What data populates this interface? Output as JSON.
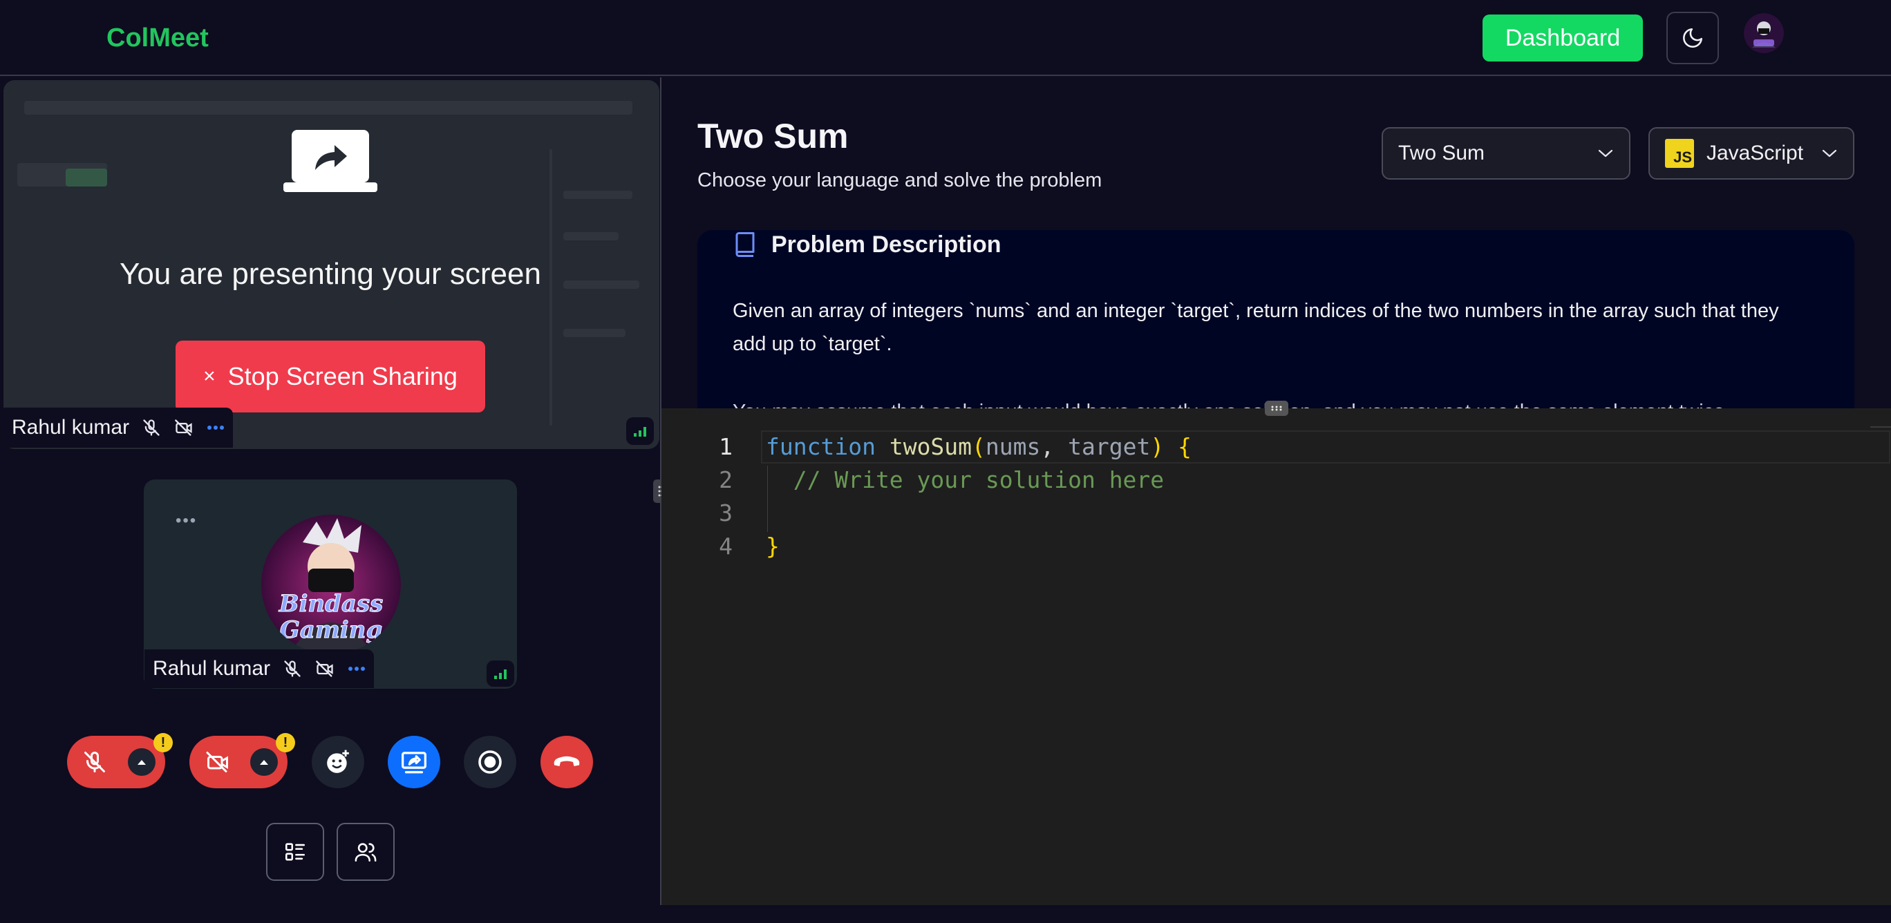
{
  "header": {
    "brand": "ColMeet",
    "dashboard_label": "Dashboard",
    "theme_icon": "moon-icon",
    "avatar_label": "Bindass Gaming"
  },
  "screen_share": {
    "message": "You are presenting your screen",
    "stop_label": "Stop Screen Sharing",
    "stop_icon": "×",
    "participant": "Rahul kumar"
  },
  "camera_tile": {
    "participant": "Rahul kumar",
    "avatar_text_1": "Bindass",
    "avatar_text_2": "Gaming"
  },
  "controls": {
    "warn_glyph": "!",
    "mic": "mic-off-icon",
    "camera": "camera-off-icon",
    "reactions": "emoji-icon",
    "share": "screen-share-icon",
    "record": "record-icon",
    "leave": "phone-hangup-icon",
    "layout": "layout-list-icon",
    "participants": "users-icon"
  },
  "problem": {
    "title": "Two Sum",
    "subtitle": "Choose your language and solve the problem",
    "selected_problem": "Two Sum",
    "selected_language": "JavaScript",
    "language_badge": "JS",
    "description_heading": "Problem Description",
    "description": "Given an array of integers `nums` and an integer `target`, return indices of the two numbers in the array such that they add up to `target`.",
    "description_next": "You may assume that each input would have exactly one solution, and you may not use the same element twice."
  },
  "editor": {
    "line_numbers": [
      "1",
      "2",
      "3",
      "4"
    ],
    "tokens": {
      "kw_function": "function",
      "fn_name": "twoSum",
      "paren_open": "(",
      "param_1": "nums",
      "comma": ", ",
      "param_2": "target",
      "paren_close": ")",
      "brace_open": " {",
      "comment": "  // Write your solution here",
      "brace_close": "}"
    }
  },
  "colors": {
    "brand": "#22c55e",
    "dashboard": "#13d962",
    "stop": "#f03b4c",
    "share_active": "#0d6efd",
    "leave": "#e03d3d"
  }
}
